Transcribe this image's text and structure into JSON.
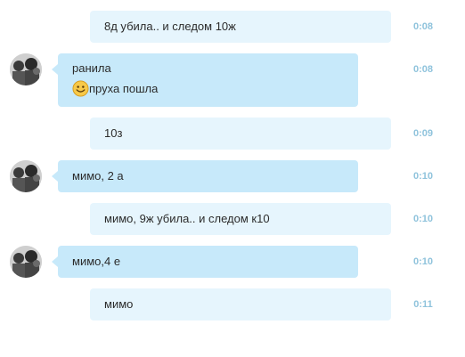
{
  "messages": [
    {
      "direction": "out",
      "text": "8д убила.. и следом 10ж",
      "time": "0:08"
    },
    {
      "direction": "in",
      "sender": "ранила",
      "text": "пруха пошла",
      "emoji": "smiley-icon",
      "time": "0:08"
    },
    {
      "direction": "out",
      "text": "10з",
      "time": "0:09"
    },
    {
      "direction": "in",
      "text": "мимо, 2 а",
      "time": "0:10"
    },
    {
      "direction": "out",
      "text": "мимо, 9ж убила.. и следом к10",
      "time": "0:10"
    },
    {
      "direction": "in",
      "text": "мимо,4 е",
      "time": "0:10"
    },
    {
      "direction": "out",
      "text": "мимо",
      "time": "0:11"
    }
  ],
  "colors": {
    "incoming_bubble": "#c7e9fa",
    "outgoing_bubble": "#e6f5fd",
    "timestamp": "#8fc3dc",
    "text": "#2b2b2b"
  }
}
